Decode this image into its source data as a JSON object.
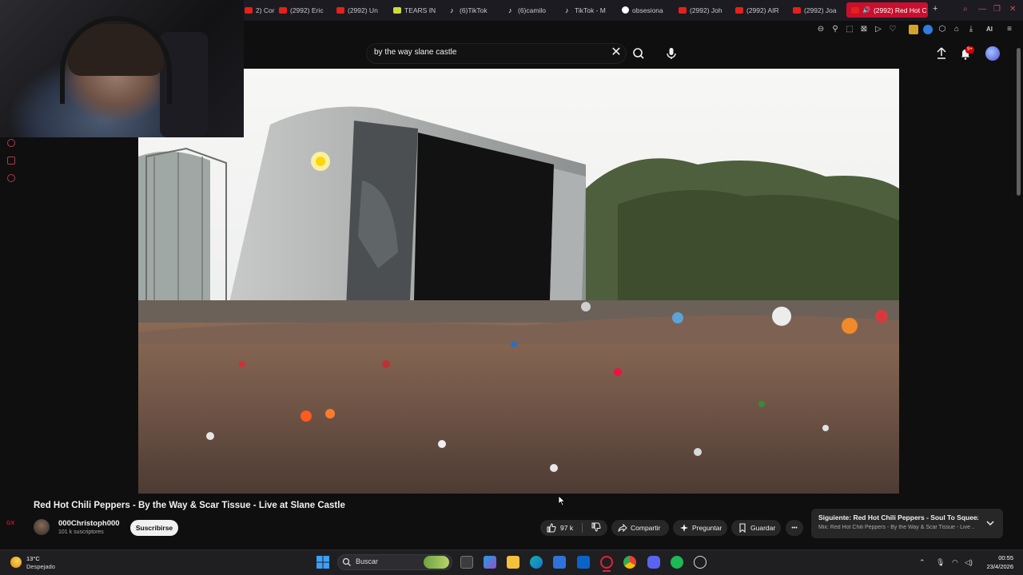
{
  "browser": {
    "tabs": [
      {
        "label": "2) Cor",
        "icon": "youtube-icon"
      },
      {
        "label": "(2992) Eric",
        "icon": "youtube-icon"
      },
      {
        "label": "(2992) Un",
        "icon": "youtube-icon"
      },
      {
        "label": "TEARS IN",
        "icon": "bookmark-icon"
      },
      {
        "label": "(6)TikTok",
        "icon": "tiktok-icon"
      },
      {
        "label": "(6)camilo",
        "icon": "tiktok-icon"
      },
      {
        "label": "TikTok - M",
        "icon": "tiktok-icon"
      },
      {
        "label": "obsesiona",
        "icon": "chrome-icon"
      },
      {
        "label": "(2992) Joh",
        "icon": "youtube-icon"
      },
      {
        "label": "(2992) AIR",
        "icon": "youtube-icon"
      },
      {
        "label": "(2992) Joa",
        "icon": "youtube-icon"
      },
      {
        "label": "(2992) Red Hot C",
        "icon": "speaker-icon",
        "active": true
      }
    ],
    "new_tab": "+",
    "ai_label": "AI",
    "accent": "#c8102e"
  },
  "youtube": {
    "search": {
      "value": "by the way slane castle",
      "clear": "✕"
    },
    "notifications_badge": "9+"
  },
  "video": {
    "title": "Red Hot Chili Peppers - By the Way & Scar Tissue - Live at Slane Castle",
    "channel": {
      "name": "000Christoph000",
      "subscribers": "101 k suscriptores"
    },
    "subscribe_label": "Suscribirse",
    "likes": "97 k",
    "share_label": "Compartir",
    "ask_label": "Preguntar",
    "save_label": "Guardar",
    "more_label": "•••"
  },
  "up_next": {
    "title": "Siguiente: Red Hot Chili Peppers - Soul To Squeeze ...",
    "subtitle": "Mix: Red Hot Chili Peppers - By the Way & Scar Tissue - Live ..."
  },
  "sidebar": {
    "gx_label": "GX"
  },
  "taskbar": {
    "weather_temp": "13°C",
    "weather_desc": "Despejado",
    "search_placeholder": "Buscar",
    "time": "00:55",
    "date": "23/4/2026",
    "apps": [
      "explorer-icon",
      "copilot-icon",
      "folder-icon",
      "edge-icon",
      "store-icon",
      "outlook-icon",
      "opera-gx-icon",
      "chrome-icon",
      "discord-icon",
      "spotify-icon",
      "steam-icon"
    ]
  }
}
